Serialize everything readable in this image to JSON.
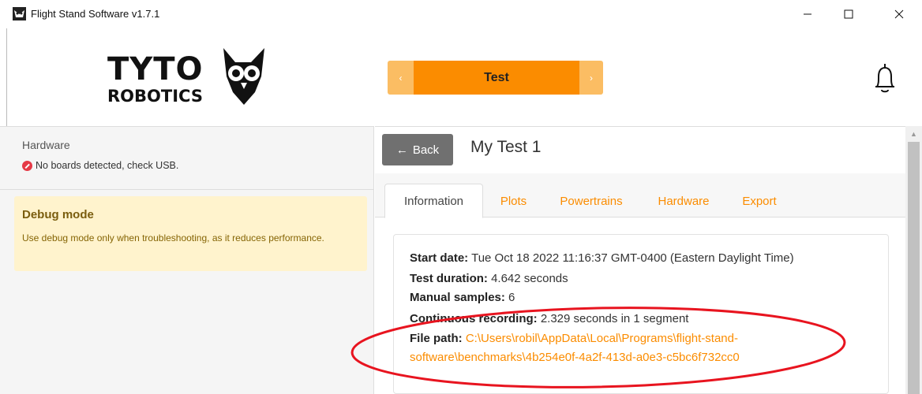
{
  "window": {
    "title": "Flight Stand Software v1.7.1"
  },
  "header": {
    "logo_text_top": "TYTO",
    "logo_text_bottom": "ROBOTICS",
    "nav_prev": "‹",
    "nav_current": "Test",
    "nav_next": "›"
  },
  "sidebar": {
    "hardware_title": "Hardware",
    "hardware_status": "No boards detected, check USB.",
    "debug_title": "Debug mode",
    "debug_text": "Use debug mode only when troubleshooting, as it reduces performance."
  },
  "main": {
    "back_label": "Back",
    "test_title": "My Test 1",
    "tabs": [
      {
        "label": "Information",
        "active": true
      },
      {
        "label": "Plots",
        "active": false
      },
      {
        "label": "Powertrains",
        "active": false
      },
      {
        "label": "Hardware",
        "active": false
      },
      {
        "label": "Export",
        "active": false
      }
    ],
    "info": {
      "start_date_label": "Start date:",
      "start_date_value": "Tue Oct 18 2022 11:16:37 GMT-0400 (Eastern Daylight Time)",
      "duration_label": "Test duration:",
      "duration_value": "4.642 seconds",
      "samples_label": "Manual samples:",
      "samples_value": "6",
      "continuous_label": "Continuous recording:",
      "continuous_value": "2.329 seconds in 1 segment",
      "file_path_label": "File path:",
      "file_path_line1": "C:\\Users\\robil\\AppData\\Local\\Programs\\flight-stand-",
      "file_path_line2": "software\\benchmarks\\4b254e0f-4a2f-413d-a0e3-c5bc6f732cc0"
    }
  },
  "colors": {
    "accent": "#fb8c00",
    "accent_light": "#fbbd63",
    "debug_bg": "#fff3cd",
    "error": "#e53946",
    "annotation": "#e8141f"
  },
  "icons": {
    "app": "owl-icon",
    "notifications": "bell-icon",
    "back": "arrow-left-icon",
    "status": "error-icon"
  }
}
